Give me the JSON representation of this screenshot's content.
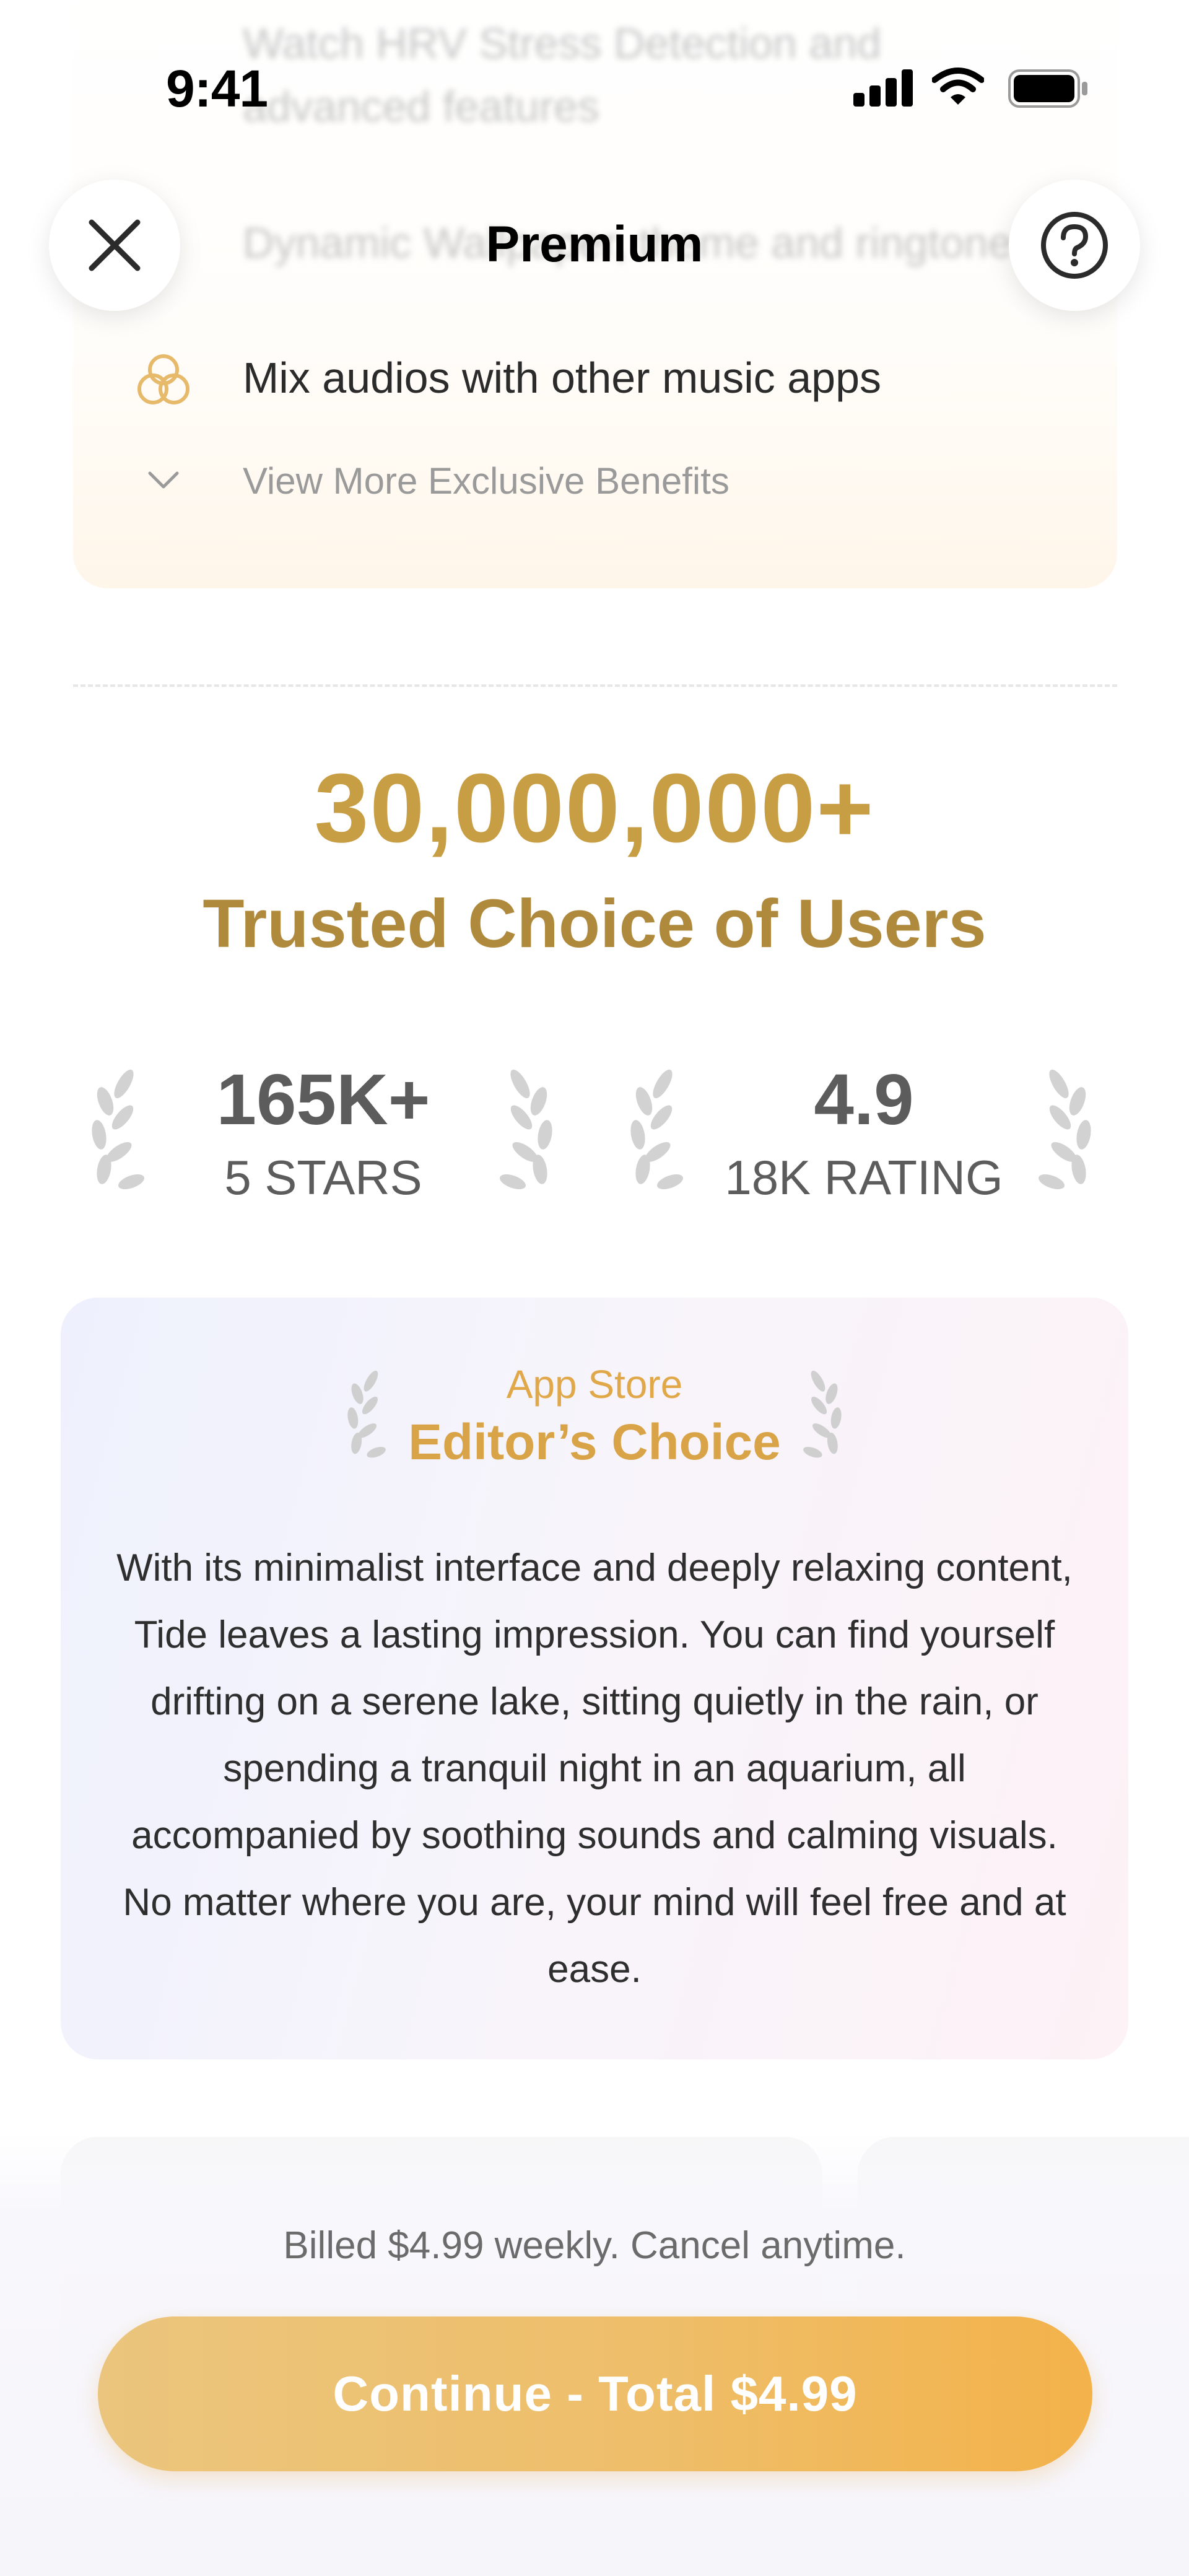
{
  "status_bar": {
    "time": "9:41"
  },
  "header": {
    "title": "Premium"
  },
  "benefits": {
    "faded_items": [
      "Watch HRV Stress Detection and",
      "advanced features",
      "Dynamic Wallpaper, theme and ringtone"
    ],
    "mix_audio": "Mix audios with other music apps",
    "view_more": "View More Exclusive Benefits"
  },
  "trust": {
    "count": "30,000,000+",
    "subtitle": "Trusted Choice of Users"
  },
  "stats": [
    {
      "value": "165K+",
      "label": "5 STARS"
    },
    {
      "value": "4.9",
      "label": "18K RATING"
    }
  ],
  "editor": {
    "source": "App Store",
    "title": "Editor’s Choice",
    "quote": "With its minimalist interface and deeply relaxing content, Tide leaves a lasting impression. You can find yourself drifting on a serene lake, sitting quietly in the rain, or spending a tranquil night in an aquarium, all accompanied by soothing sounds and calming visuals. No matter where you are, your mind will feel free and at ease."
  },
  "billing": {
    "note": "Billed $4.99 weekly. Cancel anytime.",
    "cta": "Continue - Total $4.99"
  },
  "colors": {
    "gold": "#c89e45",
    "gold_dark": "#b08a3c",
    "editor_gold": "#d9a448",
    "cta_start": "#ebc57d",
    "cta_end": "#f3b24a"
  },
  "icons": [
    "close-icon",
    "help-icon",
    "mix-audio-icon",
    "chevron-down-icon",
    "laurel-icon",
    "signal-icon",
    "wifi-icon",
    "battery-icon"
  ]
}
